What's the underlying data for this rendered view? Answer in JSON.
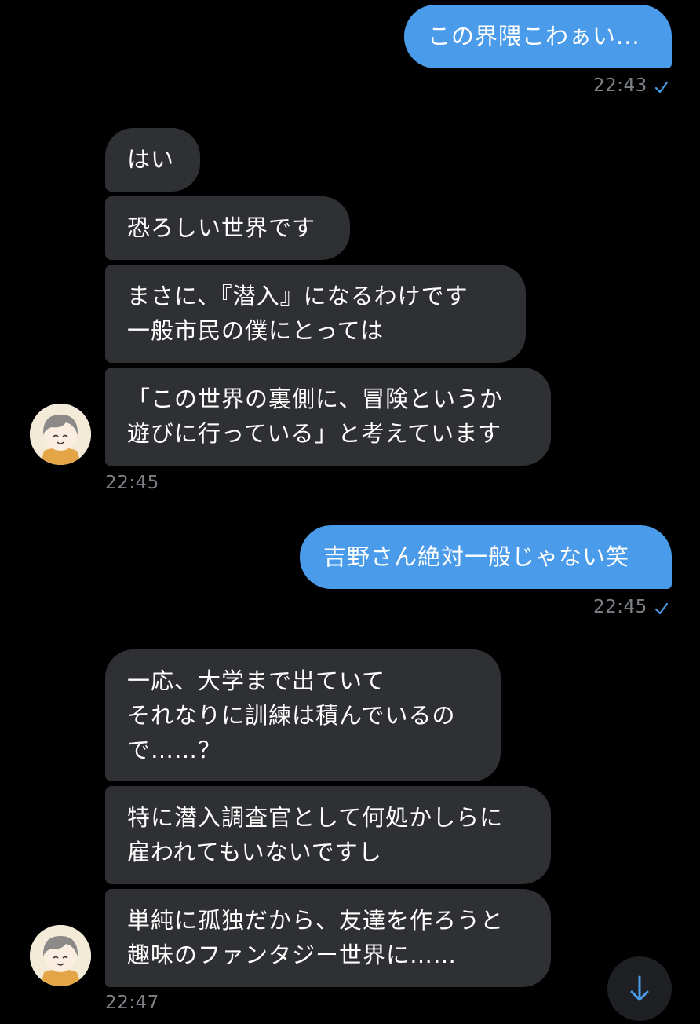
{
  "messages": [
    {
      "dir": "out",
      "text": "この界隈こわぁい..."
    },
    {
      "dir": "in",
      "text": "はい"
    },
    {
      "dir": "in",
      "text": "恐ろしい世界です"
    },
    {
      "dir": "in",
      "text": "まさに、『潜入』になるわけです\n一般市民の僕にとっては"
    },
    {
      "dir": "in",
      "text": "「この世界の裏側に、冒険というか\n遊びに行っている」と考えています"
    },
    {
      "dir": "out",
      "text": "吉野さん絶対一般じゃない笑"
    },
    {
      "dir": "in",
      "text": "一応、大学まで出ていて\nそれなりに訓練は積んでいるの\nで……？"
    },
    {
      "dir": "in",
      "text": "特に潜入調査官として何処かしらに\n雇われてもいないですし"
    },
    {
      "dir": "in",
      "text": "単純に孤独だから、友達を作ろうと\n趣味のファンタジー世界に……"
    }
  ],
  "times": [
    "22:43",
    "22:45",
    "22:45",
    "22:47"
  ],
  "colors": {
    "out_bubble": "#4a9be9",
    "in_bubble": "#2f3033",
    "read_check": "#4a9be9"
  },
  "icons": {
    "read": "checkmark-icon",
    "scroll": "arrow-down-icon"
  }
}
